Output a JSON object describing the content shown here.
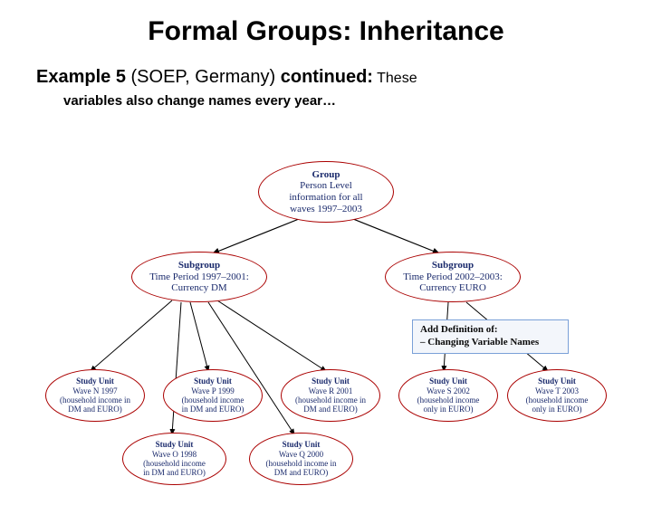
{
  "title": "Formal Groups: Inheritance",
  "subtitle_bold1": "Example 5",
  "subtitle_plain": " (SOEP, Germany) ",
  "subtitle_bold2": "continued:",
  "subtitle_trail": " These",
  "subline": "variables also change names every year…",
  "group": {
    "label": "Group",
    "line1": "Person Level",
    "line2": "information for all",
    "line3": "waves 1997–2003"
  },
  "sub1": {
    "label": "Subgroup",
    "line1": "Time Period 1997–2001:",
    "line2": "Currency DM"
  },
  "sub2": {
    "label": "Subgroup",
    "line1": "Time Period 2002–2003:",
    "line2": "Currency EURO"
  },
  "callout": {
    "l1": "Add Definition of:",
    "l2": "– Changing Variable Names"
  },
  "su1": {
    "label": "Study Unit",
    "l1": "Wave N 1997",
    "l2": "(household income in",
    "l3": "DM and EURO)"
  },
  "su2": {
    "label": "Study Unit",
    "l1": "Wave P 1999",
    "l2": "(household income",
    "l3": "in DM and EURO)"
  },
  "su3": {
    "label": "Study Unit",
    "l1": "Wave R 2001",
    "l2": "(household income in",
    "l3": "DM and EURO)"
  },
  "su4": {
    "label": "Study Unit",
    "l1": "Wave S 2002",
    "l2": "(household income",
    "l3": "only in EURO)"
  },
  "su5": {
    "label": "Study Unit",
    "l1": "Wave T 2003",
    "l2": "(household income",
    "l3": "only in EURO)"
  },
  "su6": {
    "label": "Study Unit",
    "l1": "Wave O 1998",
    "l2": "(household income",
    "l3": "in DM and EURO)"
  },
  "su7": {
    "label": "Study Unit",
    "l1": "Wave Q 2000",
    "l2": "(household income in",
    "l3": "DM and EURO)"
  }
}
